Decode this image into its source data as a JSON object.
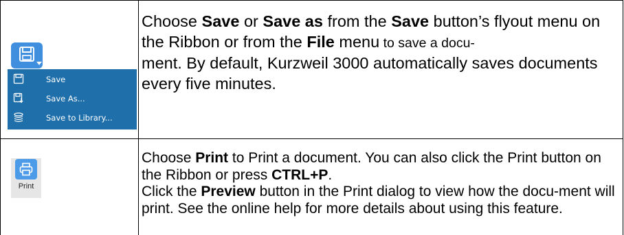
{
  "save_row": {
    "flyout_items": [
      "Save",
      "Save As...",
      "Save to Library..."
    ],
    "text": {
      "p1": "Choose ",
      "b1": "Save",
      "p2": " or ",
      "b2": "Save as",
      "p3": " from the ",
      "b3": "Save",
      "p4": " button’s flyout menu on the Ribbon or from the ",
      "b4": "File",
      "p5": " menu",
      "p6": " to save a docu-",
      "p7": "ment. By default, Kurzweil 3000 automatically saves documents every five minutes."
    }
  },
  "print_row": {
    "button_label": "Print",
    "text": {
      "p1": "Choose ",
      "b1": "Print",
      "p2": " to Print a document. You can also click the Print button on the Ribbon or press ",
      "b2": "CTRL+P",
      "p3": ".",
      "p4": "Click the ",
      "b3": "Preview",
      "p5": " button in the Print dialog to view how the docu-ment will print. See the online help for more details about using this feature."
    }
  },
  "colors": {
    "save_button": "#3f8fde",
    "flyout_bg": "#1f6fab",
    "print_button": "#4c9be8"
  },
  "icons": [
    "save-icon",
    "save-as-icon",
    "save-to-library-icon",
    "printer-icon"
  ]
}
